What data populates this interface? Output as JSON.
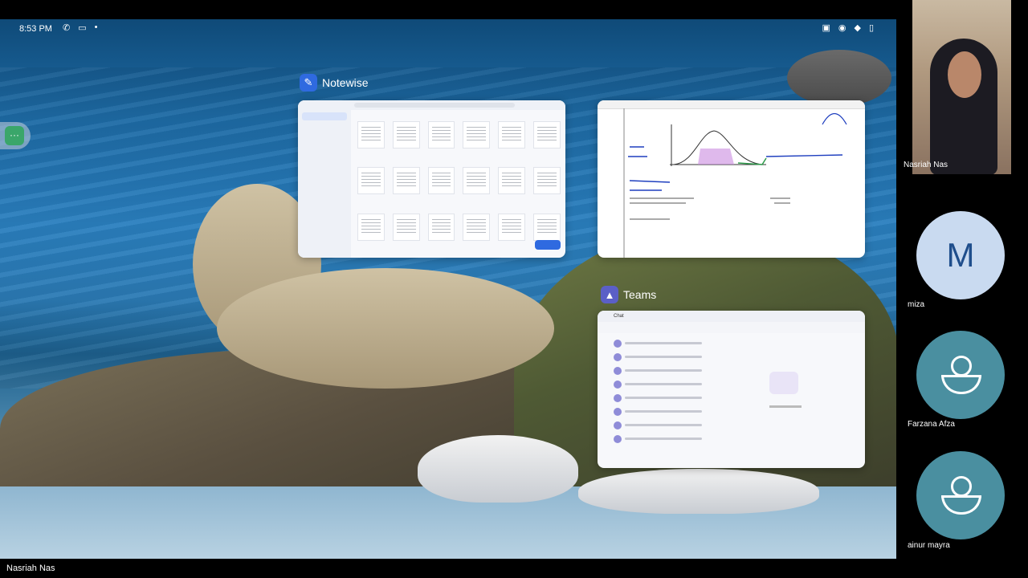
{
  "status_bar": {
    "time": "8:53 PM"
  },
  "apps": {
    "notewise": {
      "title": "Notewise"
    },
    "teams": {
      "title": "Teams",
      "chat_header": "Chat"
    }
  },
  "presenter_name_bottom": "Nasriah  Nas",
  "participants": [
    {
      "name": "Nasriah  Nas",
      "type": "video"
    },
    {
      "name": "miza",
      "type": "initial",
      "initial": "M"
    },
    {
      "name": "Farzana Afza",
      "type": "generic"
    },
    {
      "name": "ainur mayra",
      "type": "generic"
    }
  ],
  "colors": {
    "notewise_icon": "#2f6ae0",
    "teams_icon": "#5b5fc7",
    "avatar_letter_bg": "#c9daf0",
    "avatar_generic_bg": "#4a8fa0"
  }
}
